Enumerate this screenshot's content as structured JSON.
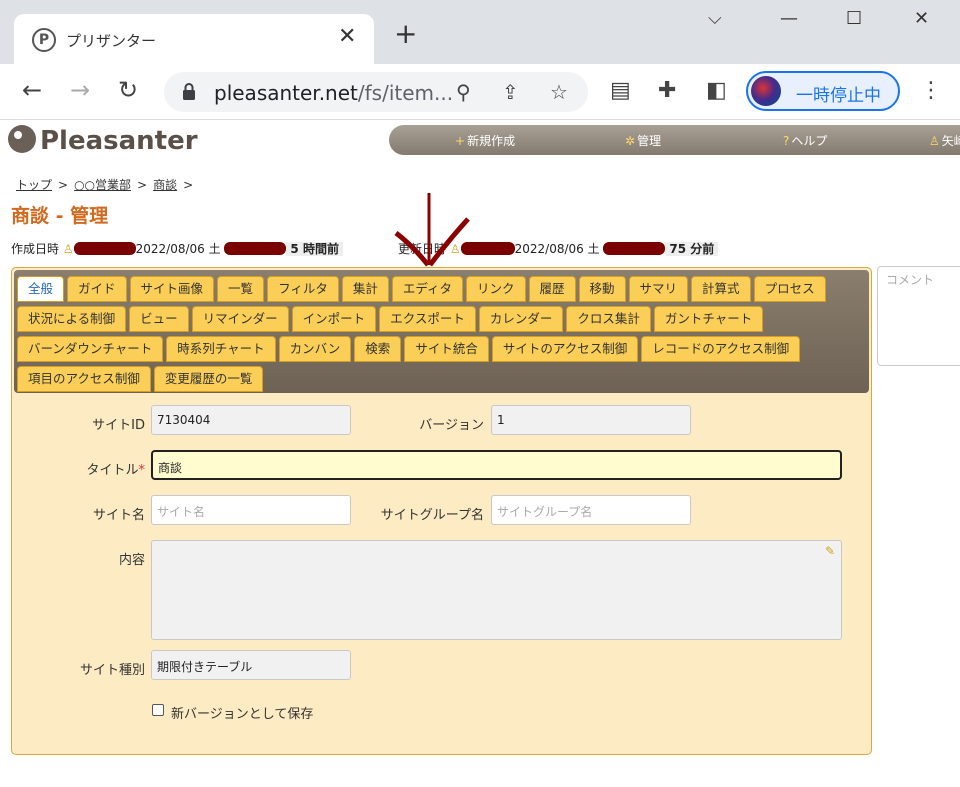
{
  "browser": {
    "tab_title": "プリザンター",
    "tab_favicon": "P",
    "url_host": "pleasanter.net",
    "url_path": "/fs/item...",
    "profile_label": "一時停止中"
  },
  "app": {
    "logo_text": "Pleasanter",
    "nav": {
      "new": "新規作成",
      "manage": "管理",
      "help": "ヘルプ",
      "user": "矢崎"
    }
  },
  "breadcrumb": [
    "トップ",
    "○○営業部",
    "商談"
  ],
  "breadcrumb_separator": ">",
  "page_title": "商談 - 管理",
  "meta": {
    "created_label": "作成日時",
    "created_date": "2022/08/06 土",
    "created_ago": "5 時間前",
    "updated_label": "更新日時",
    "updated_date": "2022/08/06 土",
    "updated_ago": "75 分前"
  },
  "comment_placeholder": "コメント",
  "tabs": {
    "row1": [
      "全般",
      "ガイド",
      "サイト画像",
      "一覧",
      "フィルタ",
      "集計",
      "エディタ",
      "リンク",
      "履歴",
      "移動",
      "サマリ",
      "計算式",
      "プロセス"
    ],
    "row2": [
      "状況による制御",
      "ビュー",
      "リマインダー",
      "インポート",
      "エクスポート",
      "カレンダー",
      "クロス集計",
      "ガントチャート"
    ],
    "row3": [
      "バーンダウンチャート",
      "時系列チャート",
      "カンバン",
      "検索",
      "サイト統合",
      "サイトのアクセス制御",
      "レコードのアクセス制御"
    ],
    "row4": [
      "項目のアクセス制御",
      "変更履歴の一覧"
    ],
    "active": "全般"
  },
  "form": {
    "site_id_label": "サイトID",
    "site_id_value": "7130404",
    "version_label": "バージョン",
    "version_value": "1",
    "title_label": "タイトル",
    "title_required": "*",
    "title_value": "商談",
    "site_name_label": "サイト名",
    "site_name_placeholder": "サイト名",
    "site_group_label": "サイトグループ名",
    "site_group_placeholder": "サイトグループ名",
    "content_label": "内容",
    "site_type_label": "サイト種別",
    "site_type_value": "期限付きテーブル",
    "new_version_label": "新バージョンとして保存"
  },
  "colors": {
    "title_orange": "#d1691e",
    "tab_yellow": "#fbcf57",
    "panel_bg": "#fdebc3",
    "annotation_red": "#8b0000"
  }
}
